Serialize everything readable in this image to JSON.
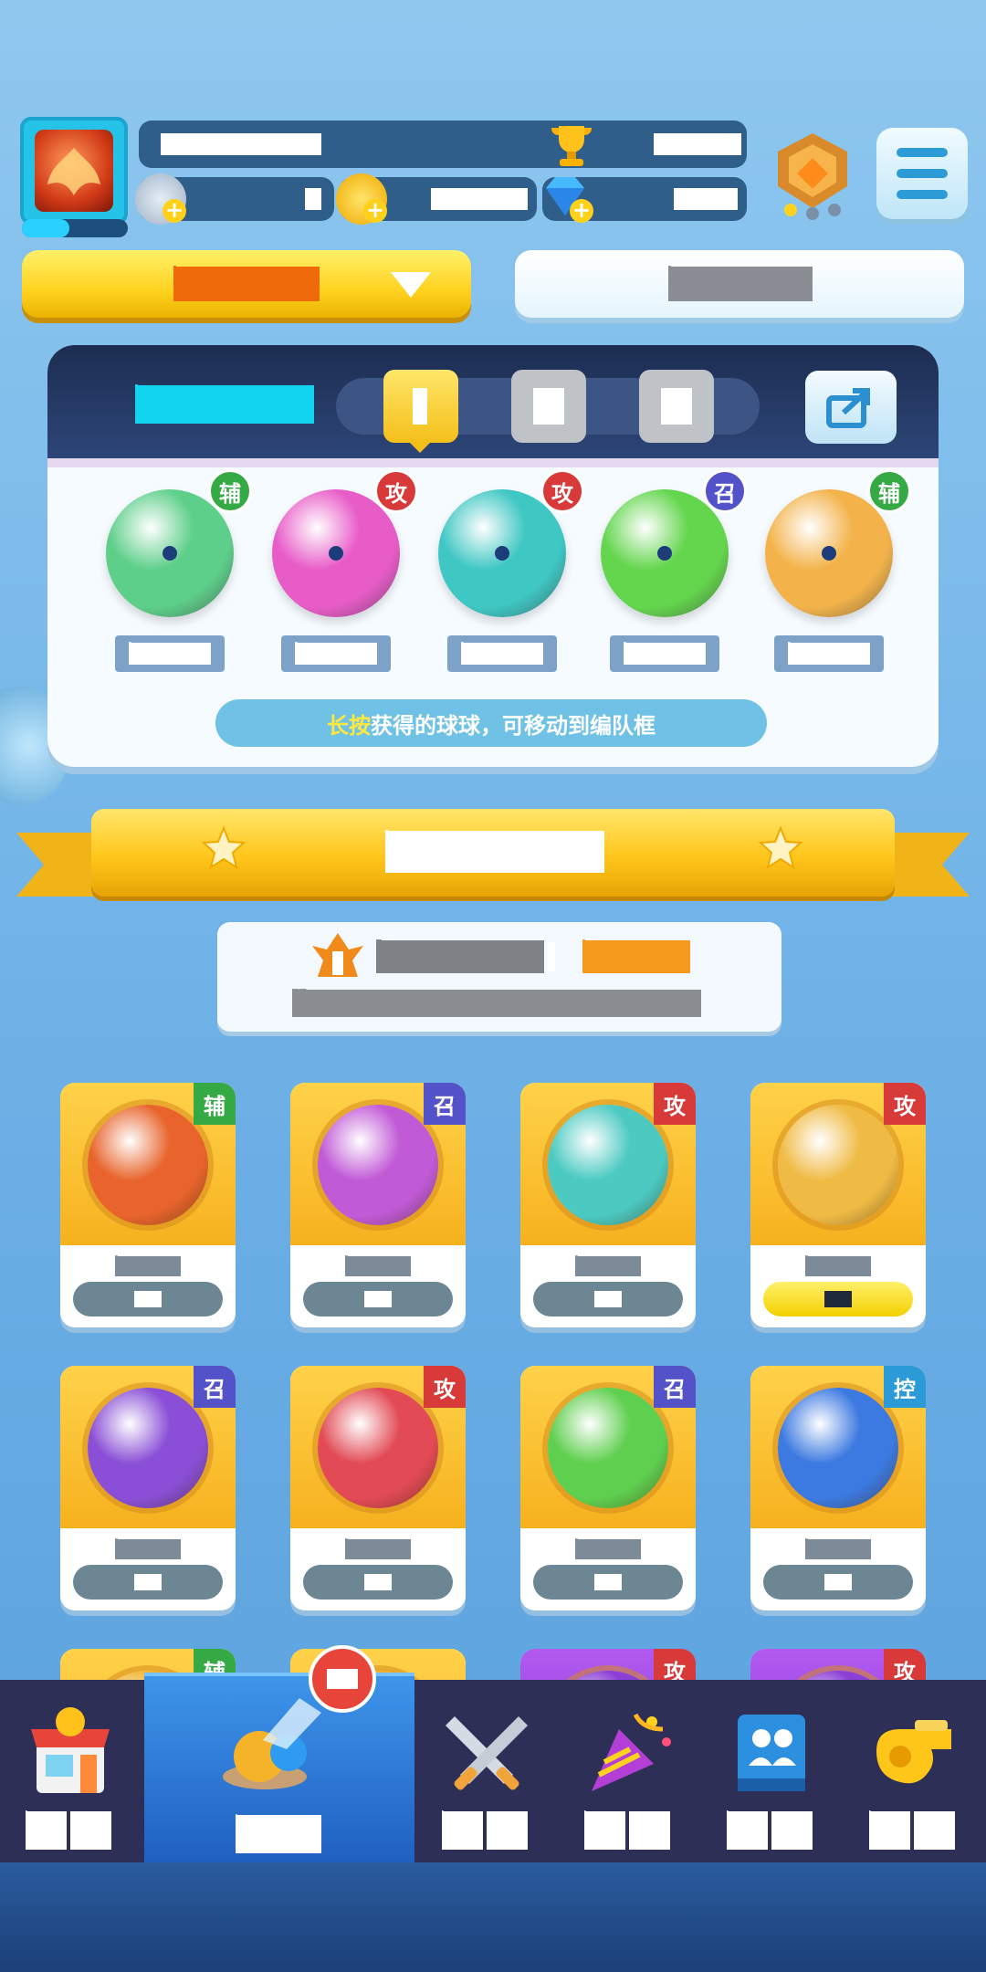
{
  "header": {
    "player_name": "███ █ ██",
    "trophies": "████",
    "silver": "█",
    "coins": "█████",
    "gems": "███",
    "mode_select_label": "████",
    "right_tab_label": "████"
  },
  "team_panel": {
    "team_name": "████",
    "tabs": [
      "I",
      "",
      ""
    ],
    "members": [
      {
        "role": "辅",
        "role_color": "#35a944",
        "ball_color": "#5ecf8a",
        "level": "██.█"
      },
      {
        "role": "攻",
        "role_color": "#d83a3a",
        "ball_color": "#e85cc8",
        "level": "██.█"
      },
      {
        "role": "攻",
        "role_color": "#d83a3a",
        "ball_color": "#3fc7c3",
        "level": "██.█"
      },
      {
        "role": "召",
        "role_color": "#5352c9",
        "ball_color": "#64d64e",
        "level": "██.█"
      },
      {
        "role": "辅",
        "role_color": "#35a944",
        "ball_color": "#f3b34a",
        "level": "██.█"
      }
    ],
    "hint_highlight": "长按",
    "hint_text": "获得的球球，可移动到编队框"
  },
  "section": {
    "title": "████",
    "info_label": "████████：",
    "info_value": "████",
    "info_sub": "█████████. ██████████"
  },
  "collection": [
    {
      "role": "辅",
      "role_color": "#35a944",
      "ball_color": "#e8642c",
      "level": "██.█",
      "selected": false
    },
    {
      "role": "召",
      "role_color": "#5352c9",
      "ball_color": "#c15ad7",
      "level": "██.█",
      "selected": false
    },
    {
      "role": "攻",
      "role_color": "#d83a3a",
      "ball_color": "#4ccac2",
      "level": "██.█",
      "selected": false
    },
    {
      "role": "攻",
      "role_color": "#d83a3a",
      "ball_color": "#f0bb45",
      "level": "██.█",
      "selected": true
    },
    {
      "role": "召",
      "role_color": "#5352c9",
      "ball_color": "#8a4fd6",
      "level": "██.█",
      "selected": false
    },
    {
      "role": "攻",
      "role_color": "#d83a3a",
      "ball_color": "#e24a55",
      "level": "██.█",
      "selected": false
    },
    {
      "role": "召",
      "role_color": "#5352c9",
      "ball_color": "#5fcf4f",
      "level": "██.█",
      "selected": false
    },
    {
      "role": "控",
      "role_color": "#2a9bd6",
      "ball_color": "#3c79e0",
      "level": "██.█",
      "selected": false
    },
    {
      "role": "辅",
      "role_color": "#35a944",
      "ball_color": "#f0b330",
      "level": "",
      "selected": false
    },
    {
      "role": "",
      "role_color": "#d83a3a",
      "ball_color": "#f0b330",
      "level": "",
      "selected": false
    },
    {
      "role": "攻",
      "role_color": "#d83a3a",
      "ball_color": "#8a3fd6",
      "level": "",
      "selected": false
    },
    {
      "role": "攻",
      "role_color": "#d83a3a",
      "ball_color": "#8a3fd6",
      "level": "",
      "selected": false
    }
  ],
  "nav": [
    {
      "label": "██",
      "icon": "shop-icon",
      "active": false
    },
    {
      "label": "██",
      "icon": "balls-icon",
      "active": true
    },
    {
      "label": "██",
      "icon": "swords-icon",
      "active": false
    },
    {
      "label": "██",
      "icon": "party-icon",
      "active": false
    },
    {
      "label": "██",
      "icon": "guild-book-icon",
      "active": false
    },
    {
      "label": "██",
      "icon": "whistle-icon",
      "active": false
    }
  ]
}
